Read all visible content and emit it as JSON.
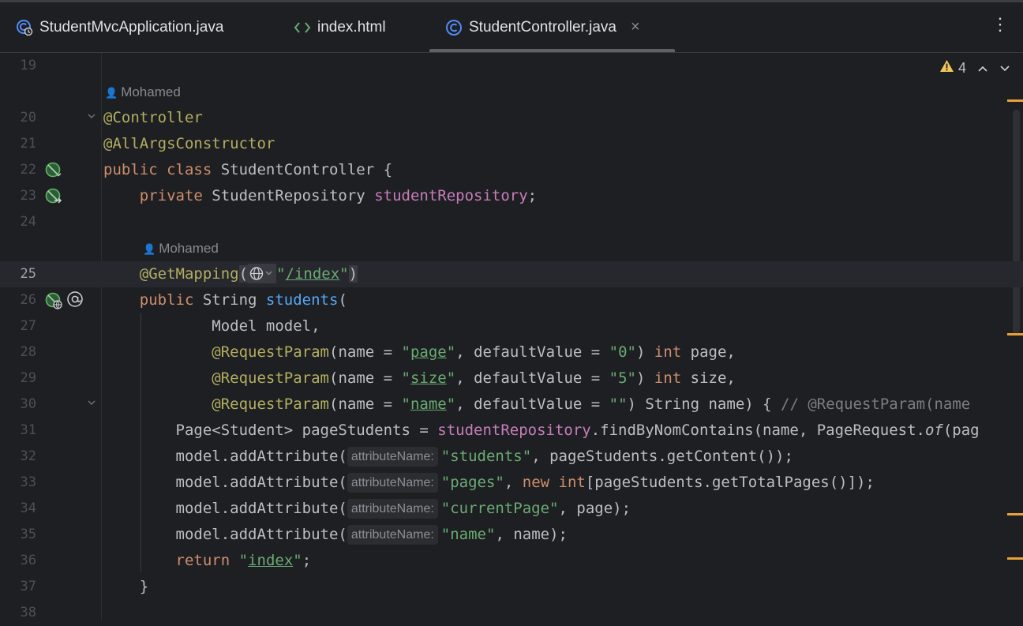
{
  "tabs": [
    {
      "label": "StudentMvcApplication.java",
      "icon": "spring-class-icon"
    },
    {
      "label": "index.html",
      "icon": "html-file-icon"
    },
    {
      "label": "StudentController.java",
      "icon": "class-icon",
      "active": true,
      "close": "×"
    }
  ],
  "more_menu": "⋮",
  "inspections": {
    "warning_count": "4",
    "up": "^",
    "down": "v"
  },
  "author": "Mohamed",
  "hint_label": "attributeName:",
  "lines": {
    "l19": "19",
    "l20": "20",
    "l21": "21",
    "l22": "22",
    "l23": "23",
    "l24": "24",
    "l25": "25",
    "l26": "26",
    "l27": "27",
    "l28": "28",
    "l29": "29",
    "l30": "30",
    "l31": "31",
    "l32": "32",
    "l33": "33",
    "l34": "34",
    "l35": "35",
    "l36": "36",
    "l37": "37",
    "l38": "38"
  },
  "code": {
    "c20": "@Controller",
    "c21": "@AllArgsConstructor",
    "c22_kw": "public class",
    "c22_rest": " StudentController {",
    "c23_kw": "private",
    "c23_type": " StudentRepository ",
    "c23_field": "studentRepository",
    "c23_end": ";",
    "c25_ann": "@GetMapping",
    "c25_open": "(",
    "c25_q1": "\"",
    "c25_path": "/index",
    "c25_q2": "\"",
    "c25_close": ")",
    "c26_kw": "public",
    "c26_type": " String ",
    "c26_fn": "students",
    "c26_paren": "(",
    "c27": "Model model,",
    "c28_ann": "@RequestParam",
    "c28_a": "(name = ",
    "c28_q1": "\"",
    "c28_s": "page",
    "c28_q2": "\"",
    "c28_b": ", defaultValue = ",
    "c28_d": "\"0\"",
    "c28_c": ") ",
    "c28_kw": "int",
    "c28_e": " page,",
    "c29_ann": "@RequestParam",
    "c29_a": "(name = ",
    "c29_q1": "\"",
    "c29_s": "size",
    "c29_q2": "\"",
    "c29_b": ", defaultValue = ",
    "c29_d": "\"5\"",
    "c29_c": ") ",
    "c29_kw": "int",
    "c29_e": " size,",
    "c30_ann": "@RequestParam",
    "c30_a": "(name = ",
    "c30_q1": "\"",
    "c30_s": "name",
    "c30_q2": "\"",
    "c30_b": ", defaultValue = ",
    "c30_d": "\"\"",
    "c30_c": ") String name) { ",
    "c30_cmt": "// @RequestParam(name",
    "c31_a": "Page<Student> pageStudents = ",
    "c31_field": "studentRepository",
    "c31_b": ".findByNomContains(name, PageRequest.",
    "c31_it": "of",
    "c31_c": "(pag",
    "c32_a": "model.addAttribute(",
    "c32_s": "\"students\"",
    "c32_b": ", pageStudents.getContent());",
    "c33_a": "model.addAttribute(",
    "c33_s": "\"pages\"",
    "c33_b": ", ",
    "c33_kw": "new int",
    "c33_c": "[pageStudents.getTotalPages()]);",
    "c34_a": "model.addAttribute(",
    "c34_s": "\"currentPage\"",
    "c34_b": ", page);",
    "c35_a": "model.addAttribute(",
    "c35_s": "\"name\"",
    "c35_b": ", name);",
    "c36_kw": "return",
    "c36_sp": " ",
    "c36_q1": "\"",
    "c36_s": "index",
    "c36_q2": "\"",
    "c36_end": ";",
    "c37": "}"
  },
  "colors": {
    "background": "#1e1f22",
    "annotation": "#b3ae60",
    "keyword": "#cf8e6d",
    "field": "#c77dbb",
    "string": "#6aab73",
    "method": "#56a8f5",
    "warning": "#f2c55c"
  }
}
